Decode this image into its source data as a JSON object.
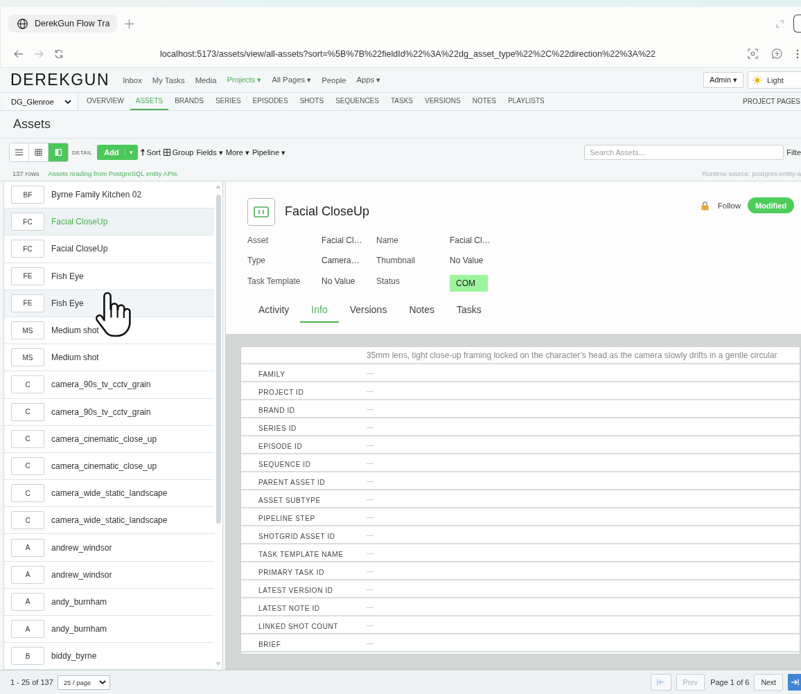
{
  "browser": {
    "tab_title": "DerekGun Flow Tra",
    "url": "localhost:5173/assets/view/all-assets?sort=%5B%7B%22fieldId%22%3A%22dg_asset_type%22%2C%22direction%22%3A%22"
  },
  "app_nav": {
    "logo": "DEREKGUN",
    "links": [
      {
        "label": "Inbox",
        "selected": false
      },
      {
        "label": "My Tasks",
        "selected": false
      },
      {
        "label": "Media",
        "selected": false
      },
      {
        "label": "Projects ▾",
        "selected": true
      },
      {
        "label": "All Pages ▾",
        "selected": false
      },
      {
        "label": "People",
        "selected": false
      },
      {
        "label": "Apps ▾",
        "selected": false
      }
    ],
    "user_menu": "Admin ▾",
    "theme": "Light"
  },
  "project_bar": {
    "project": "DG_Glenroe",
    "tabs": [
      {
        "label": "OVERVIEW",
        "selected": false
      },
      {
        "label": "ASSETS",
        "selected": true
      },
      {
        "label": "BRANDS",
        "selected": false
      },
      {
        "label": "SERIES",
        "selected": false
      },
      {
        "label": "EPISODES",
        "selected": false
      },
      {
        "label": "SHOTS",
        "selected": false
      },
      {
        "label": "SEQUENCES",
        "selected": false
      },
      {
        "label": "TASKS",
        "selected": false
      },
      {
        "label": "VERSIONS",
        "selected": false
      },
      {
        "label": "NOTES",
        "selected": false
      },
      {
        "label": "PLAYLISTS",
        "selected": false
      }
    ],
    "pages_link": "PROJECT PAGES"
  },
  "page_title": "Assets",
  "toolbar": {
    "views": [
      {
        "kind": "list",
        "selected": false
      },
      {
        "kind": "grid",
        "selected": false
      },
      {
        "kind": "detail",
        "selected": true
      }
    ],
    "view_label": "DETAIL",
    "add": {
      "label": "Add",
      "caret": "▾"
    },
    "actions": [
      {
        "kind": "sort",
        "label": "Sort"
      },
      {
        "kind": "group",
        "label": "Group"
      },
      {
        "kind": "menu",
        "label": "Fields ▾"
      },
      {
        "kind": "menu",
        "label": "More ▾"
      },
      {
        "kind": "menu",
        "label": "Pipeline ▾"
      }
    ],
    "search": {
      "placeholder": "Search Assets..."
    },
    "filter": "Filte"
  },
  "status_line": {
    "rows": "137 rows",
    "note": "Assets reading from PostgreSQL entity APIs.",
    "runtime": "Runtime source: postgres-entity-a"
  },
  "asset_list": [
    {
      "initials": "BF",
      "name": "Byrne Family Kitchen 02",
      "selected": false,
      "hovered": false
    },
    {
      "initials": "FC",
      "name": "Facial CloseUp",
      "selected": true,
      "hovered": false
    },
    {
      "initials": "FC",
      "name": "Facial CloseUp",
      "selected": false,
      "hovered": false
    },
    {
      "initials": "FE",
      "name": "Fish Eye",
      "selected": false,
      "hovered": false
    },
    {
      "initials": "FE",
      "name": "Fish Eye",
      "selected": false,
      "hovered": true
    },
    {
      "initials": "MS",
      "name": "Medium shot",
      "selected": false,
      "hovered": false
    },
    {
      "initials": "MS",
      "name": "Medium shot",
      "selected": false,
      "hovered": false
    },
    {
      "initials": "C",
      "name": "camera_90s_tv_cctv_grain",
      "selected": false,
      "hovered": false
    },
    {
      "initials": "C",
      "name": "camera_90s_tv_cctv_grain",
      "selected": false,
      "hovered": false
    },
    {
      "initials": "C",
      "name": "camera_cinematic_close_up",
      "selected": false,
      "hovered": false
    },
    {
      "initials": "C",
      "name": "camera_cinematic_close_up",
      "selected": false,
      "hovered": false
    },
    {
      "initials": "C",
      "name": "camera_wide_static_landscape",
      "selected": false,
      "hovered": false
    },
    {
      "initials": "C",
      "name": "camera_wide_static_landscape",
      "selected": false,
      "hovered": false
    },
    {
      "initials": "A",
      "name": "andrew_windsor",
      "selected": false,
      "hovered": false
    },
    {
      "initials": "A",
      "name": "andrew_windsor",
      "selected": false,
      "hovered": false
    },
    {
      "initials": "A",
      "name": "andy_burnham",
      "selected": false,
      "hovered": false
    },
    {
      "initials": "A",
      "name": "andy_burnham",
      "selected": false,
      "hovered": false
    },
    {
      "initials": "B",
      "name": "biddy_byrne",
      "selected": false,
      "hovered": false
    }
  ],
  "detail": {
    "title": "Facial CloseUp",
    "follow": "Follow",
    "state_button": "Modified",
    "fields": [
      {
        "kind": "text",
        "label": "Asset",
        "value": "Facial Cl…"
      },
      {
        "kind": "text",
        "label": "Name",
        "value": "Facial Cl…"
      },
      {
        "kind": "text",
        "label": "Type",
        "value": "Camera…"
      },
      {
        "kind": "text",
        "label": "Thumbnail",
        "value": "No Value"
      },
      {
        "kind": "text",
        "label": "Task Template",
        "value": "No Value"
      },
      {
        "kind": "status",
        "label": "Status",
        "value": "COM"
      }
    ],
    "tabs": [
      {
        "label": "Activity",
        "selected": false
      },
      {
        "label": "Info",
        "selected": true
      },
      {
        "label": "Versions",
        "selected": false
      },
      {
        "label": "Notes",
        "selected": false
      },
      {
        "label": "Tasks",
        "selected": false
      }
    ],
    "description": "35mm lens, tight close-up framing locked on the character’s head as the camera slowly drifts in a gentle circular",
    "info_rows": [
      {
        "label": "FAMILY",
        "value": "—"
      },
      {
        "label": "PROJECT ID",
        "value": "—"
      },
      {
        "label": "BRAND ID",
        "value": "—"
      },
      {
        "label": "SERIES ID",
        "value": "—"
      },
      {
        "label": "EPISODE ID",
        "value": "—"
      },
      {
        "label": "SEQUENCE ID",
        "value": "—"
      },
      {
        "label": "PARENT ASSET ID",
        "value": "—"
      },
      {
        "label": "ASSET SUBTYPE",
        "value": "—"
      },
      {
        "label": "PIPELINE STEP",
        "value": "—"
      },
      {
        "label": "SHOTGRID ASSET ID",
        "value": "—"
      },
      {
        "label": "TASK TEMPLATE NAME",
        "value": "—"
      },
      {
        "label": "PRIMARY TASK ID",
        "value": "—"
      },
      {
        "label": "LATEST VERSION ID",
        "value": "—"
      },
      {
        "label": "LATEST NOTE ID",
        "value": "—"
      },
      {
        "label": "LINKED SHOT COUNT",
        "value": "—"
      },
      {
        "label": "BRIEF",
        "value": "—"
      }
    ]
  },
  "pager": {
    "range": "1 - 25 of 137",
    "page_size": "25 / page",
    "back": [
      {
        "kind": "first",
        "disabled": true
      },
      {
        "kind": "prev",
        "label": "Prev",
        "disabled": true
      }
    ],
    "page_label": "Page 1 of 6",
    "forward": [
      {
        "kind": "next",
        "label": "Next",
        "disabled": false
      },
      {
        "kind": "last",
        "disabled": false
      }
    ]
  }
}
